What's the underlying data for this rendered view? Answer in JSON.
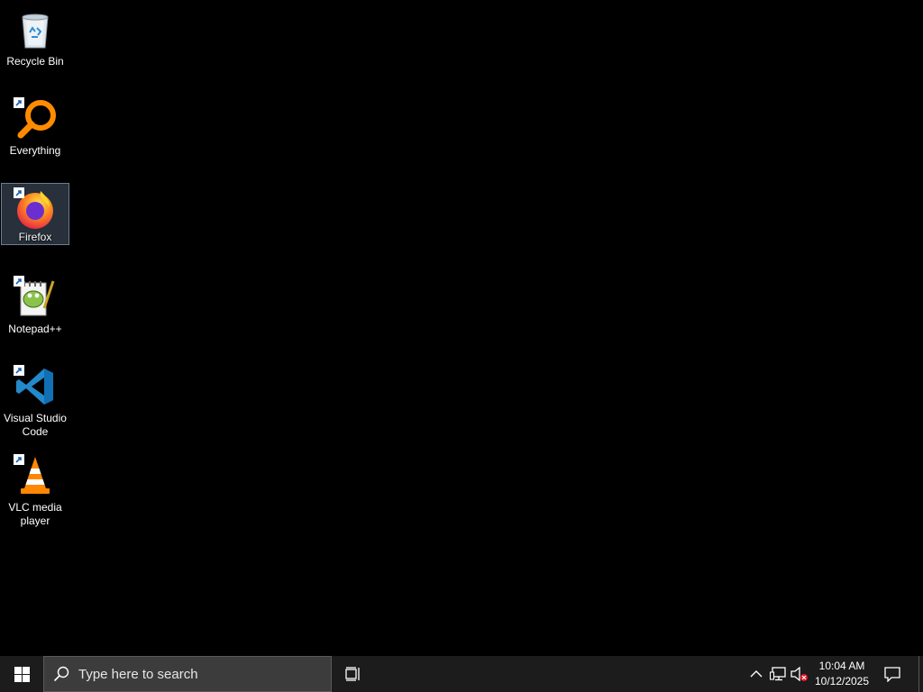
{
  "desktop": {
    "background": "#000000",
    "icons": [
      {
        "label": "Recycle Bin",
        "icon": "recycle-bin-icon",
        "shortcut": false,
        "selected": false
      },
      {
        "label": "Everything",
        "icon": "everything-search-icon",
        "shortcut": true,
        "selected": false
      },
      {
        "label": "Firefox",
        "icon": "firefox-icon",
        "shortcut": true,
        "selected": true
      },
      {
        "label": "Notepad++",
        "icon": "notepad-plus-plus-icon",
        "shortcut": true,
        "selected": false
      },
      {
        "label": "Visual Studio Code",
        "icon": "vscode-icon",
        "shortcut": true,
        "selected": false
      },
      {
        "label": "VLC media player",
        "icon": "vlc-icon",
        "shortcut": true,
        "selected": false
      }
    ]
  },
  "taskbar": {
    "start_icon": "windows-logo-icon",
    "search_placeholder": "Type here to search",
    "search_icon": "search-icon",
    "task_view_icon": "task-view-icon",
    "tray": {
      "overflow_icon": "chevron-up-icon",
      "network_icon": "network-icon",
      "volume_icon": "volume-muted-icon",
      "time": "10:04 AM",
      "date": "10/12/2025",
      "notifications_icon": "action-center-icon"
    },
    "colors": {
      "bar": "#1c1c1c",
      "search": "#3c3c3c",
      "accent_blue": "#0078d7"
    }
  }
}
